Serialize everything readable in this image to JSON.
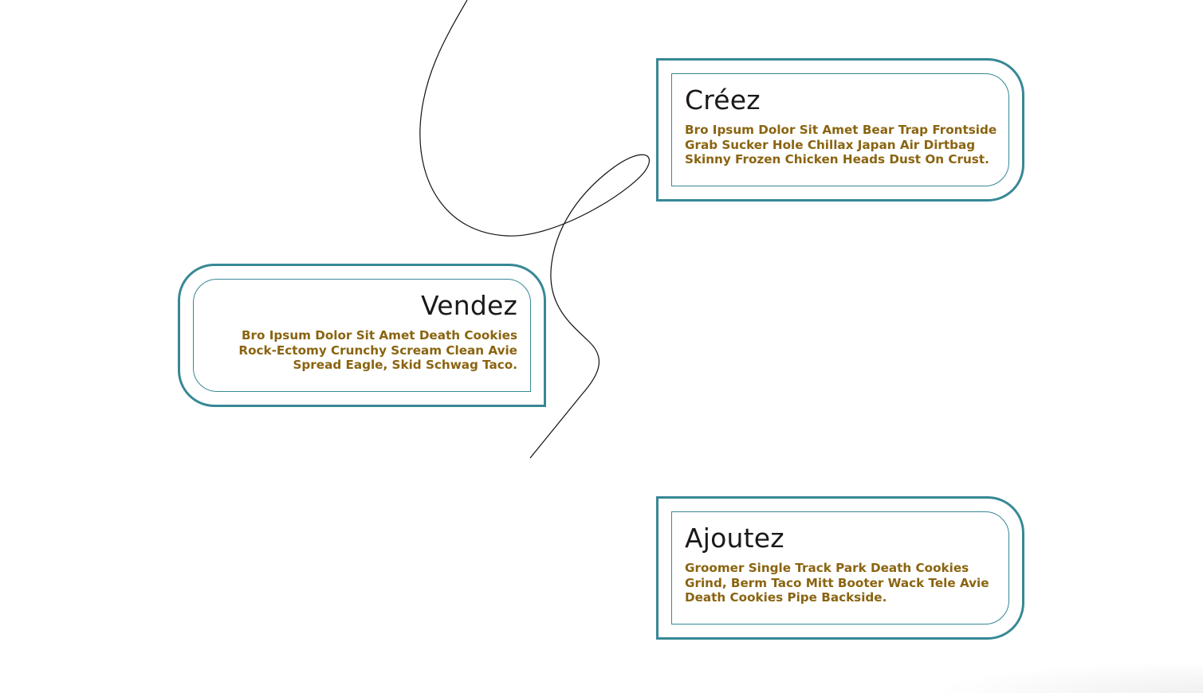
{
  "cards": {
    "creez": {
      "title": "Créez",
      "body": "Bro Ipsum Dolor Sit Amet Bear Trap Frontside Grab Sucker Hole Chillax Japan Air Dirtbag Skinny Frozen Chicken Heads Dust On Crust."
    },
    "vendez": {
      "title": "Vendez",
      "body": "Bro Ipsum Dolor Sit Amet Death Cookies Rock-Ectomy Crunchy Scream Clean Avie Spread Eagle, Skid Schwag Taco."
    },
    "ajoutez": {
      "title": "Ajoutez",
      "body": "Groomer Single Track Park Death Cookies Grind, Berm Taco Mitt Booter Wack Tele Avie Death Cookies Pipe Backside."
    }
  },
  "colors": {
    "card_border": "#378895",
    "title_text": "#1a1a1a",
    "body_text": "#8a6410",
    "background": "#ffffff",
    "curve": "#111111"
  }
}
